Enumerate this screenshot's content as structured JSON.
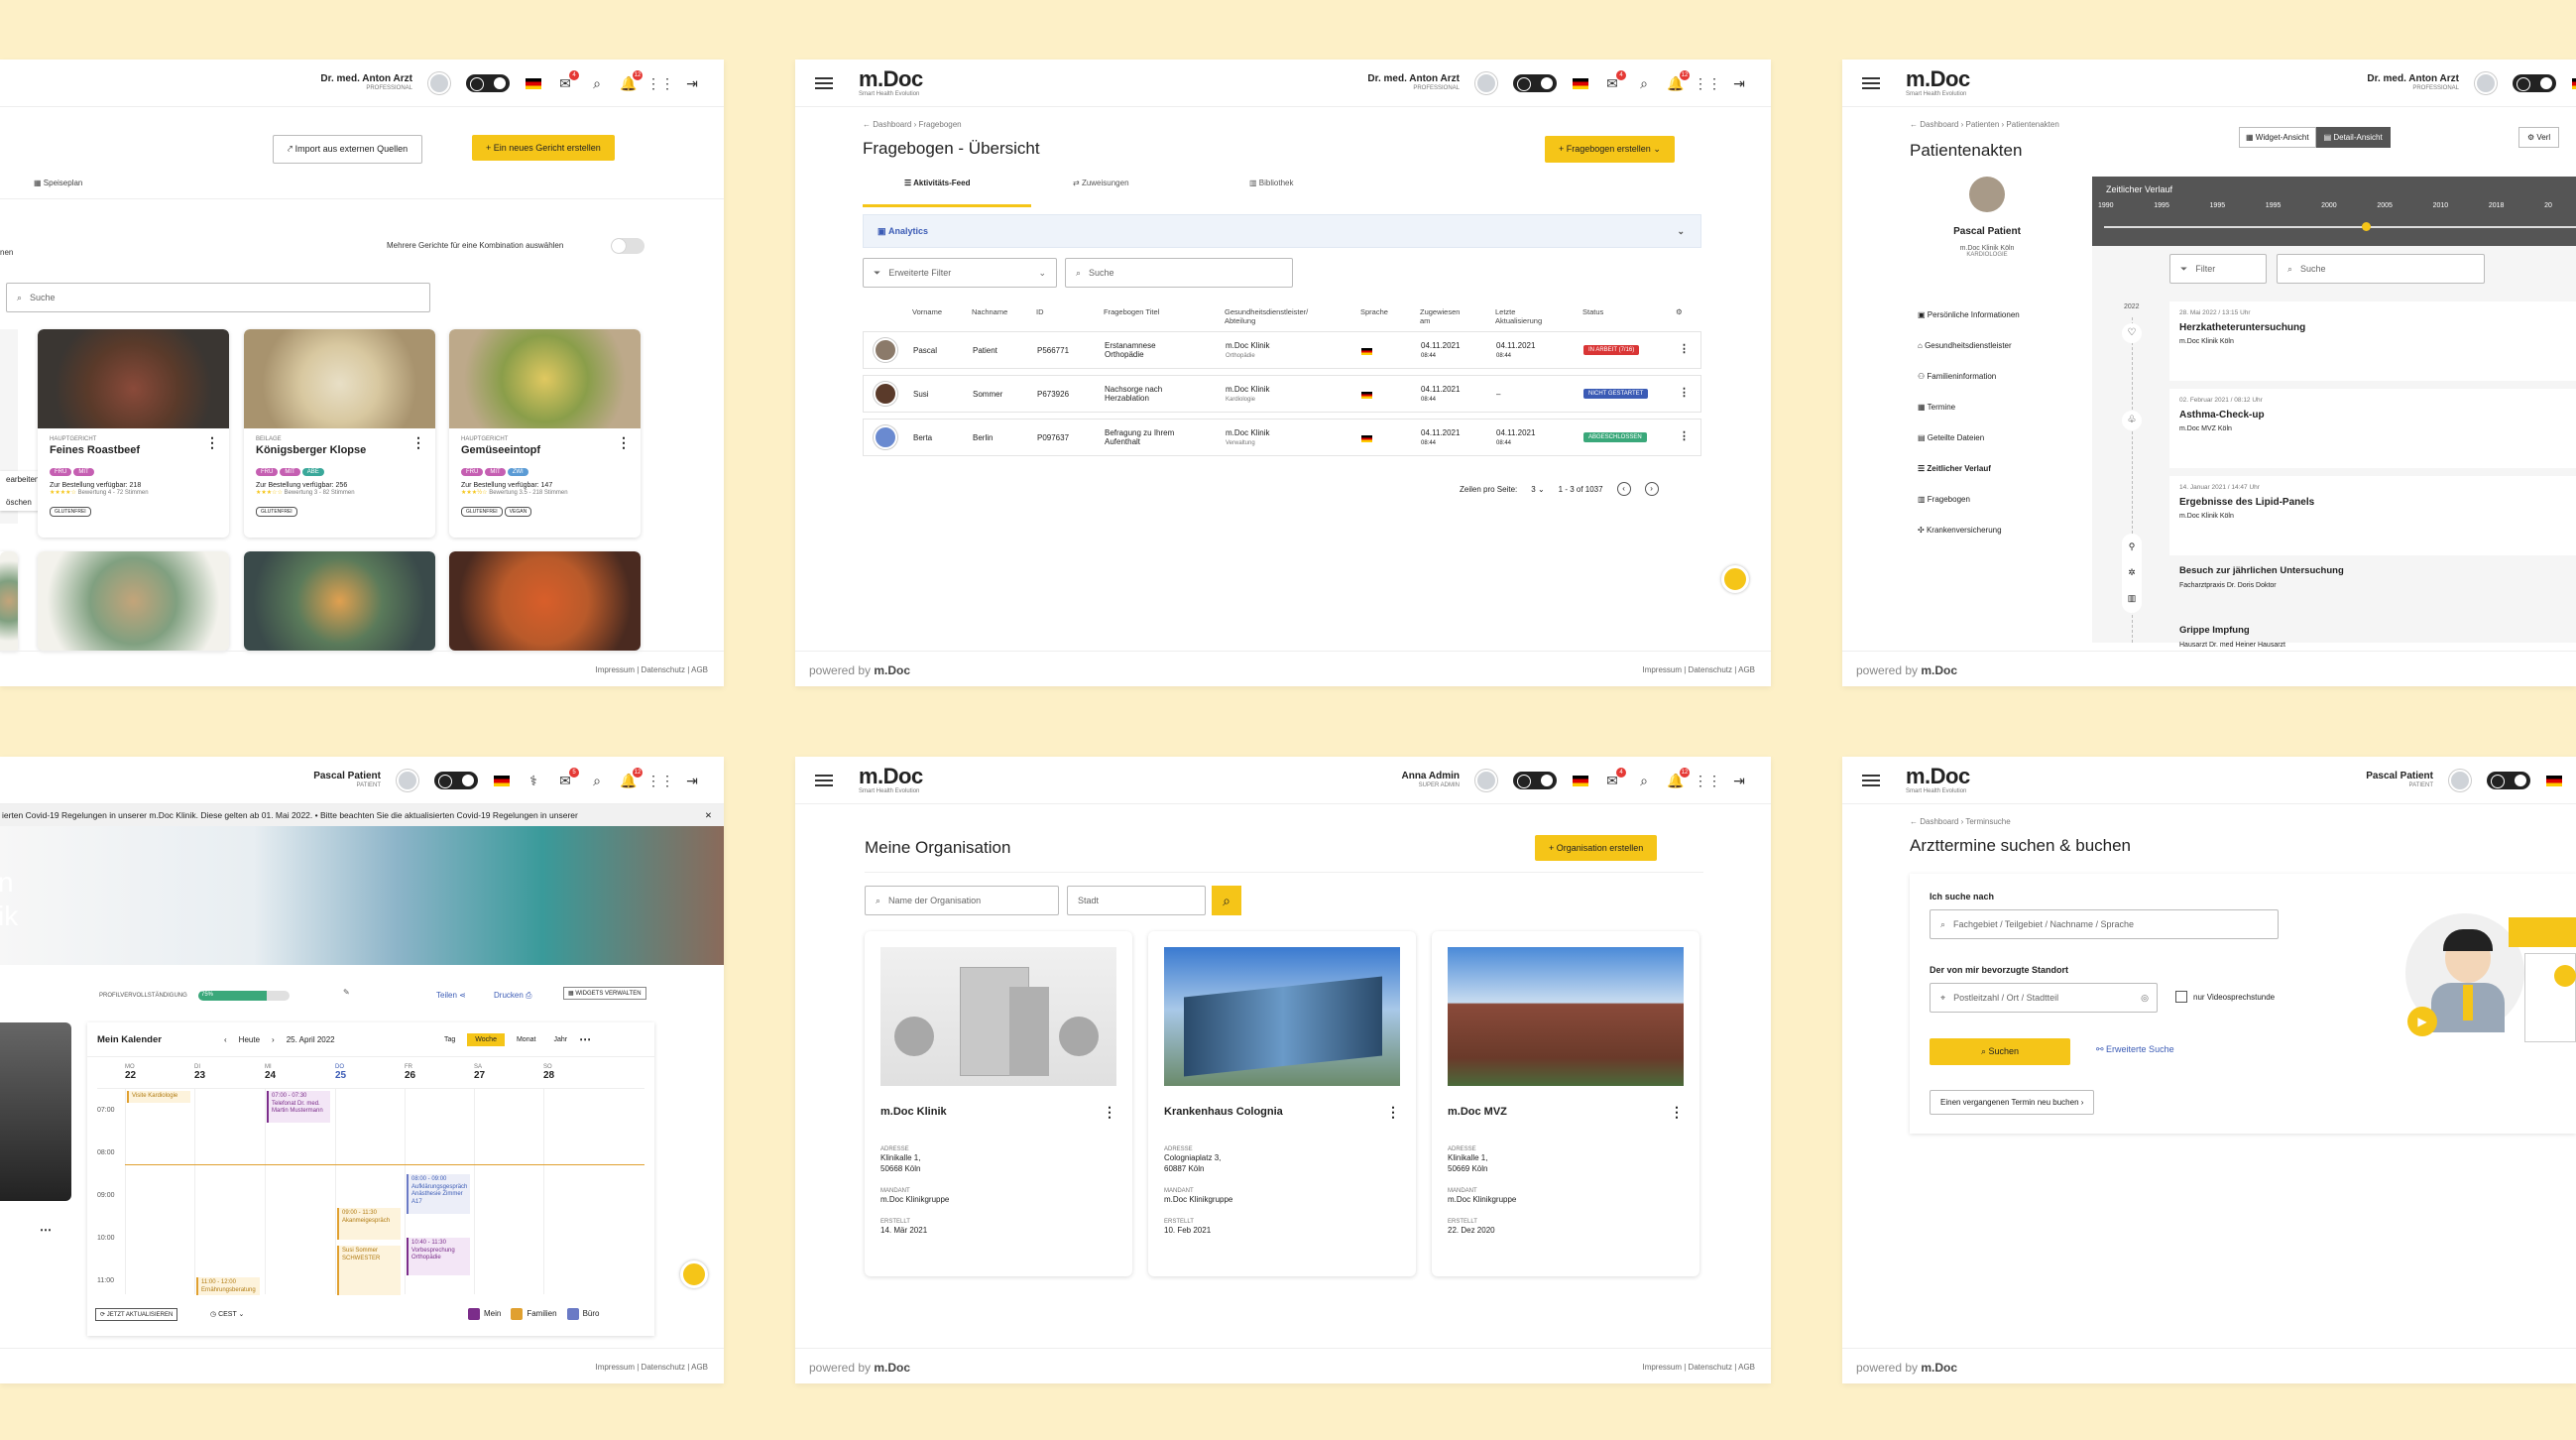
{
  "common": {
    "logo": "m.Doc",
    "logo_sub": "Smart Health Evolution",
    "powered_by": "powered by",
    "powered_logo": "m.Doc",
    "footer_links": "Impressum  |  Datenschutz  |  AGB"
  },
  "p1": {
    "user_name": "Dr. med. Anton Arzt",
    "user_role": "PROFESSIONAL",
    "notif1": "4",
    "notif2": "12",
    "import_btn": "Import aus externen Quellen",
    "new_dish_btn": "+ Ein neues Gericht erstellen",
    "tab": "Speiseplan",
    "left_partial": "nen",
    "combo_label": "Mehrere Gerichte für eine Kombination auswählen",
    "search_placeholder": "Suche",
    "edit_label": "earbeiten",
    "delete_label": "öschen",
    "cards": [
      {
        "cat": "HAUPTGERICHT",
        "title": "Feines Roastbeef",
        "tags": [
          "FRÜ",
          "MIT"
        ],
        "avail": "Zur Bestellung verfügbar: 218",
        "rating": "Bewertung 4 - 72 Stimmen",
        "otags": [
          "GLUTENFREI"
        ]
      },
      {
        "cat": "BEILAGE",
        "title": "Königsberger Klopse",
        "tags": [
          "FRÜ",
          "MIT",
          "ABE"
        ],
        "avail": "Zur Bestellung verfügbar: 256",
        "rating": "Bewertung 3 - 82 Stimmen",
        "otags": [
          "GLUTENFREI"
        ]
      },
      {
        "cat": "HAUPTGERICHT",
        "title": "Gemüseeintopf",
        "tags": [
          "FRÜ",
          "MIT",
          "ZWI"
        ],
        "avail": "Zur Bestellung verfügbar: 147",
        "rating": "Bewertung 3.5 - 218 Stimmen",
        "otags": [
          "GLUTENFREI",
          "VEGAN"
        ]
      }
    ]
  },
  "p2": {
    "user_name": "Dr. med. Anton Arzt",
    "user_role": "PROFESSIONAL",
    "notif1": "4",
    "notif2": "12",
    "crumb1": "Dashboard",
    "crumb2": "Fragebogen",
    "title": "Fragebogen - Übersicht",
    "create_btn": "+ Fragebogen erstellen",
    "tabs": [
      "Aktivitäts-Feed",
      "Zuweisungen",
      "Bibliothek"
    ],
    "analytics": "Analytics",
    "filter": "Erweiterte Filter",
    "search": "Suche",
    "headers": [
      "Vorname",
      "Nachname",
      "ID",
      "Fragebogen Titel",
      "Gesundheitsdienstleister/ Abteilung",
      "Sprache",
      "Zugewiesen am",
      "Letzte Aktualisierung",
      "Status"
    ],
    "rows": [
      {
        "first": "Pascal",
        "last": "Patient",
        "id": "P566771",
        "title": "Erstanamnese Orthopädie",
        "prov": "m.Doc Klinik",
        "dept": "Orthopädie",
        "assigned": "04.11.2021",
        "assigned_t": "08:44",
        "updated": "04.11.2021",
        "updated_t": "08:44",
        "status": "IN ARBEIT (7/16)",
        "status_color": "#d93535"
      },
      {
        "first": "Susi",
        "last": "Sommer",
        "id": "P673926",
        "title": "Nachsorge nach Herzablation",
        "prov": "m.Doc Klinik",
        "dept": "Kardiologie",
        "assigned": "04.11.2021",
        "assigned_t": "08:44",
        "updated": "–",
        "updated_t": "",
        "status": "NICHT GESTARTET",
        "status_color": "#3b5bb5"
      },
      {
        "first": "Berta",
        "last": "Berlin",
        "id": "P097637",
        "title": "Befragung zu Ihrem Aufenthalt",
        "prov": "m.Doc Klinik",
        "dept": "Verwaltung",
        "assigned": "04.11.2021",
        "assigned_t": "08:44",
        "updated": "04.11.2021",
        "updated_t": "08:44",
        "status": "ABGESCHLOSSEN",
        "status_color": "#3aa87a"
      }
    ],
    "rows_per_page_label": "Zeilen pro Seite:",
    "rows_per_page": "3",
    "range": "1 - 3 of 1037"
  },
  "p3": {
    "user_name": "Dr. med. Anton Arzt",
    "user_role": "PROFESSIONAL",
    "crumb1": "Dashboard",
    "crumb2": "Patienten",
    "crumb3": "Patientenakten",
    "title": "Patientenakten",
    "widget_view": "Widget-Ansicht",
    "detail_view": "Detail-Ansicht",
    "extra_btn": "Verl",
    "patient_name": "Pascal Patient",
    "patient_clinic": "m.Doc Klinik Köln",
    "patient_dept": "KARDIOLOGIE",
    "menu": [
      "Persönliche Informationen",
      "Gesundheitsdienstleister",
      "Familieninformation",
      "Termine",
      "Geteilte Dateien",
      "Zeitlicher Verlauf",
      "Fragebogen",
      "Krankenversicherung"
    ],
    "timeline_title": "Zeitlicher Verlauf",
    "years": [
      "1990",
      "1995",
      "1995",
      "1995",
      "2000",
      "2005",
      "2010",
      "2018",
      "20"
    ],
    "filter": "Filter",
    "search": "Suche",
    "year_label": "2022",
    "events": [
      {
        "date": "28. Mai 2022 / 13:15 Uhr",
        "title": "Herzkatheteruntersuchung",
        "place": "m.Doc Klinik Köln"
      },
      {
        "date": "02. Februar 2021 / 08:12 Uhr",
        "title": "Asthma-Check-up",
        "place": "m.Doc MVZ Köln"
      },
      {
        "date": "14. Januar 2021 / 14:47 Uhr",
        "title": "Ergebnisse des Lipid-Panels",
        "place": "m.Doc Klinik Köln"
      },
      {
        "date": "",
        "title": "Besuch zur jährlichen Untersuchung",
        "place": "Facharztpraxis Dr. Doris Doktor"
      },
      {
        "date": "",
        "title": "Grippe Impfung",
        "place": "Hausarzt Dr. med Heiner Hausarzt"
      }
    ]
  },
  "p4": {
    "user_name": "Pascal Patient",
    "user_role": "PATIENT",
    "notif1": "5",
    "notif2": "12",
    "banner": "ierten Covid-19 Regelungen in unserer m.Doc Klinik. Diese gelten ab 01. Mai 2022.  •  Bitte beachten Sie die aktualisierten Covid-19 Regelungen in unserer",
    "hero_partial1": "n",
    "hero_partial2": "ik",
    "profile_label": "PROFILVERVOLLSTÄNDIGUNG",
    "profile_pct": "75%",
    "profile_value": 0.75,
    "share": "Teilen",
    "print": "Drucken",
    "widgets": "WIDGETS VERWALTEN",
    "cal_title": "Mein Kalender",
    "today": "Heute",
    "date": "25. April 2022",
    "views": [
      "Tag",
      "Woche",
      "Monat",
      "Jahr"
    ],
    "days": [
      {
        "d": "MO",
        "n": "22"
      },
      {
        "d": "DI",
        "n": "23"
      },
      {
        "d": "MI",
        "n": "24"
      },
      {
        "d": "DO",
        "n": "25"
      },
      {
        "d": "FR",
        "n": "26"
      },
      {
        "d": "SA",
        "n": "27"
      },
      {
        "d": "SO",
        "n": "28"
      }
    ],
    "hours": [
      "07:00",
      "08:00",
      "09:00",
      "10:00",
      "11:00"
    ],
    "ev1": "Visite Kardiologie",
    "ev2": "07:00 - 07:30 Telefonat Dr. med. Martin Mustermann",
    "ev3": "08:00 - 09:00 Aufklärungsgespräch Anästhesie Zimmer A17",
    "ev4": "09:00 - 11:30 Akanmeigespräch",
    "ev5": "Susi Sommer SCHWESTER",
    "ev6": "10:40 - 11:30 Vorbesprechung Orthopädie",
    "ev7": "11:00 - 12:00 Ernährungsberatung",
    "update_btn": "JETZT AKTUALISIEREN",
    "tz": "CEST",
    "legend": [
      "Mein",
      "Familien",
      "Büro"
    ]
  },
  "p5": {
    "user_name": "Anna Admin",
    "user_role": "SUPER ADMIN",
    "notif1": "4",
    "notif2": "12",
    "title": "Meine Organisation",
    "create_btn": "+ Organisation erstellen",
    "name_ph": "Name der Organisation",
    "city_ph": "Stadt",
    "orgs": [
      {
        "name": "m.Doc Klinik",
        "addr1": "Klinikalle 1,",
        "addr2": "50668 Köln",
        "mandant": "m.Doc Klinikgruppe",
        "created": "14. Mär 2021"
      },
      {
        "name": "Krankenhaus Colognia",
        "addr1": "Cologniaplatz 3,",
        "addr2": "60887 Köln",
        "mandant": "m.Doc Klinikgruppe",
        "created": "10. Feb 2021"
      },
      {
        "name": "m.Doc MVZ",
        "addr1": "Klinikalle 1,",
        "addr2": "50669 Köln",
        "mandant": "m.Doc Klinikgruppe",
        "created": "22. Dez 2020"
      }
    ],
    "lbl_addr": "ADRESSE",
    "lbl_mandant": "MANDANT",
    "lbl_created": "ERSTELLT"
  },
  "p6": {
    "user_name": "Pascal Patient",
    "user_role": "PATIENT",
    "crumb1": "Dashboard",
    "crumb2": "Terminsuche",
    "title": "Arzttermine suchen & buchen",
    "q1": "Ich suche nach",
    "q1_ph": "Fachgebiet / Teilgebiet / Nachname / Sprache",
    "q2": "Der von mir bevorzugte Standort",
    "q2_ph": "Postleitzahl / Ort / Stadtteil",
    "video": "nur Videosprechstunde",
    "search_btn": "Suchen",
    "adv": "Erweiterte Suche",
    "past_btn": "Einen vergangenen Termin neu buchen"
  }
}
